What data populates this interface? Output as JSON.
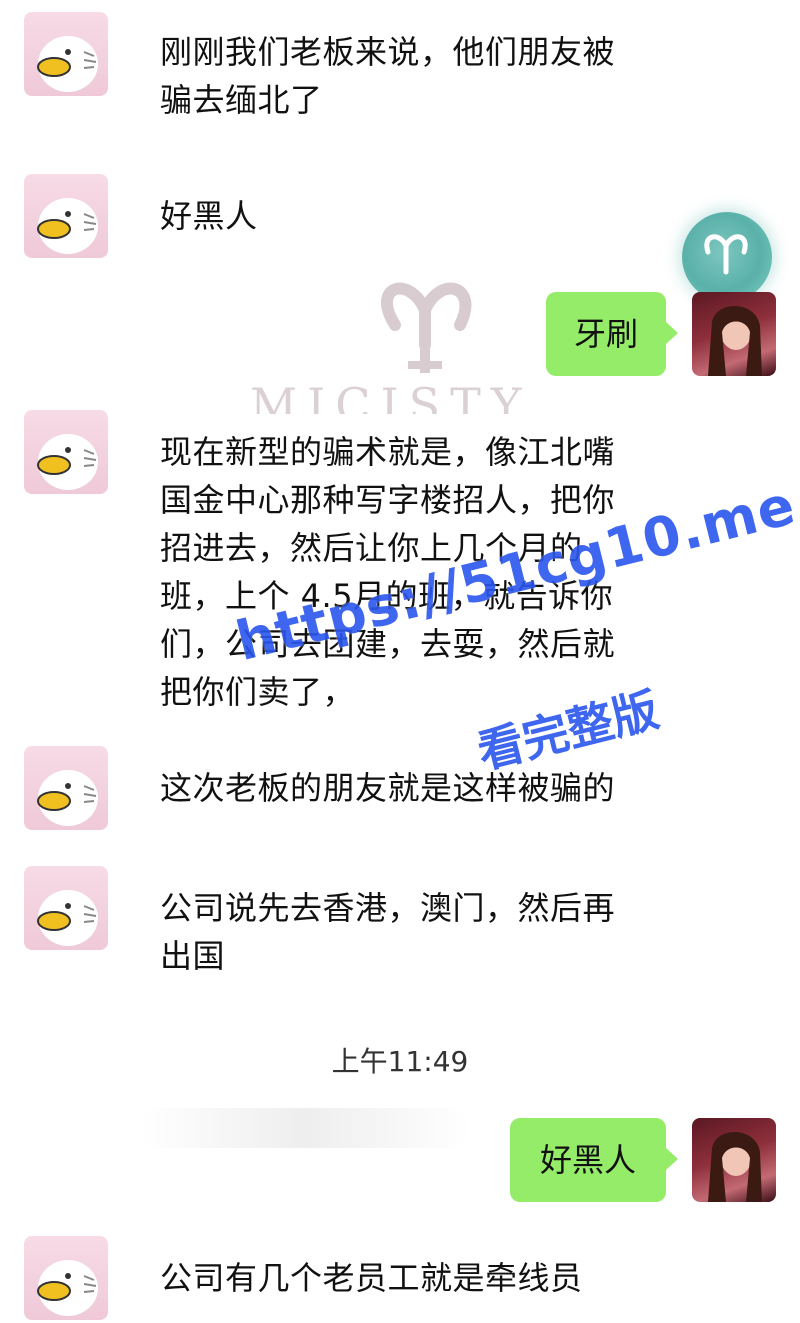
{
  "messages": {
    "m1": "刚刚我们老板来说，他们朋友被\n骗去缅北了",
    "m2": "好黑人",
    "m3_out": "牙刷",
    "m4": "现在新型的骗术就是，像江北嘴\n国金中心那种写字楼招人，把你\n招进去，然后让你上几个月的\n班，上个 4.5月的班，就告诉你\n们，公司去团建，去耍，然后就\n把你们卖了，",
    "m5": "这次老板的朋友就是这样被骗的",
    "m6": "公司说先去香港，澳门，然后再\n出国",
    "timestamp": "上午11:49",
    "m7_out": "好黑人",
    "m8": "公司有几个老员工就是牵线员"
  },
  "overlays": {
    "background_watermark_text": "MICISTY",
    "url_watermark": "https://51cg10.me",
    "url_watermark_sub": "看完整版"
  },
  "colors": {
    "outgoing_bubble": "#95ec69",
    "watermark_blue": "#2b56ee",
    "background": "#ffffff"
  },
  "icons": {
    "contact_avatar": "duck-avatar-icon",
    "self_avatar": "profile-photo-avatar",
    "badge": "aries-symbol-icon"
  }
}
